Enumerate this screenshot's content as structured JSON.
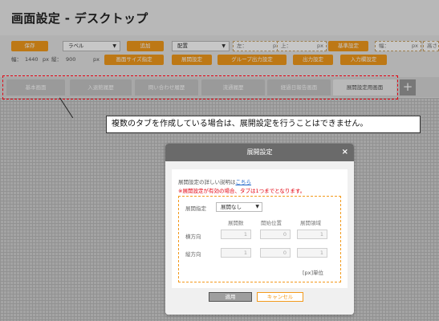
{
  "page": {
    "title": "画面設定 - デスクトップ"
  },
  "toolbar": {
    "row1": {
      "save": "保存",
      "label_select": "ラベル",
      "add": "追加",
      "align_select": "配置",
      "left_label": "左：",
      "left_unit": "px",
      "top_label": "上：",
      "top_unit": "px",
      "base_settings": "基準設定",
      "width_label": "幅：",
      "width_unit": "px",
      "height_label": "高さ："
    },
    "row2": {
      "w_label": "幅：",
      "w_value": "1440",
      "w_unit": "px",
      "h_label": "縦：",
      "h_value": "900",
      "h_unit": "px",
      "screen_size": "画面サイズ指定",
      "expand": "展開設定",
      "group_output": "グループ出力設定",
      "output": "出力設定",
      "input_detection": "入力欄設定"
    }
  },
  "tabs": [
    {
      "label": "基本画面"
    },
    {
      "label": "入退館履歴"
    },
    {
      "label": "問い合わせ履歴"
    },
    {
      "label": "流通履歴"
    },
    {
      "label": "経過日報告画面"
    },
    {
      "label": "展開設定用画面"
    }
  ],
  "tabs_add": "+",
  "callout": {
    "text": "複数のタブを作成している場合は、展開設定を行うことはできません。"
  },
  "dialog": {
    "title": "展開設定",
    "close": "×",
    "help_prefix": "展開設定の詳しい説明は",
    "help_link": "こちら",
    "warning": "※展開設定が有効の場合、タブは1つまでとなります。",
    "expand_label": "展開指定",
    "expand_value": "展開なし",
    "col_count": "展開数",
    "col_start": "開始位置",
    "col_area": "展開領域",
    "row_horizontal": "横方向",
    "row_vertical": "縦方向",
    "h_count": "1",
    "h_start": "0",
    "h_area": "1",
    "v_count": "1",
    "v_start": "0",
    "v_area": "1",
    "unit": "[px]単位",
    "ok": "適用",
    "cancel": "キャンセル"
  },
  "colors": {
    "accent": "#f39a1c",
    "warning": "#e3000f",
    "link": "#1f64c8"
  }
}
